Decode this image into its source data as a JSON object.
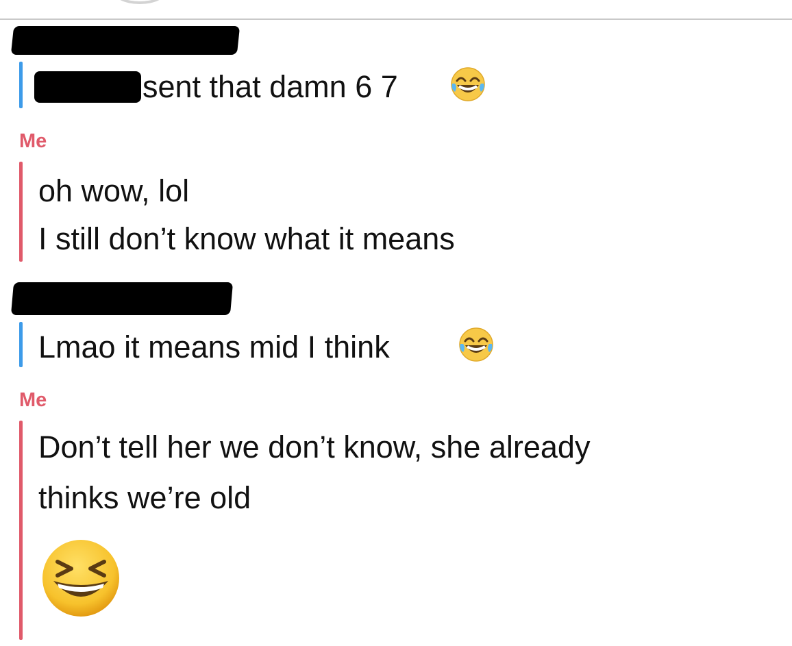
{
  "messages": [
    {
      "sender": "",
      "redacted": true,
      "lines": [
        "sent that damn 6 7"
      ],
      "trailing_emoji": "face-with-tears-of-joy-icon",
      "accent": "#3d9be9"
    },
    {
      "sender": "Me",
      "redacted": false,
      "lines": [
        "oh wow, lol",
        "I still don’t know what it means"
      ],
      "accent": "#e05a6a"
    },
    {
      "sender": "",
      "redacted": true,
      "lines": [
        "Lmao it means mid I think"
      ],
      "trailing_emoji": "face-with-tears-of-joy-icon",
      "accent": "#3d9be9"
    },
    {
      "sender": "Me",
      "redacted": false,
      "lines": [
        "Don’t tell her we don’t know, she already",
        "thinks we’re old"
      ],
      "big_emoji": "grinning-squinting-face-icon",
      "accent": "#e05a6a"
    }
  ]
}
